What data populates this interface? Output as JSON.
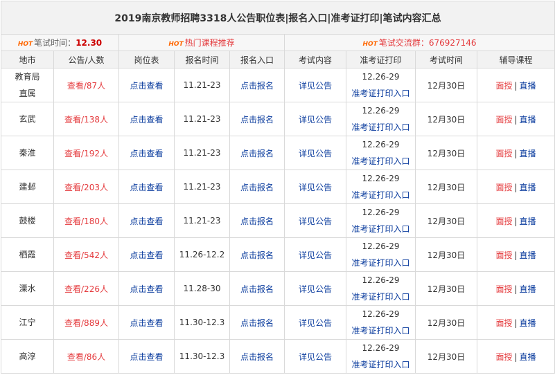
{
  "title": "2019南京教师招聘3318人公告职位表|报名入口|准考证打印|笔试内容汇总",
  "info": {
    "hot_tag": "HOT",
    "exam_time_label": "笔试时间：",
    "exam_time_value": "12.30",
    "hot_courses": "热门课程推荐",
    "group_label": "笔试交流群：",
    "group_value": "676927146"
  },
  "headers": [
    "地市",
    "公告/人数",
    "岗位表",
    "报名时间",
    "报名入口",
    "考试内容",
    "准考证打印",
    "考试时间",
    "辅导课程"
  ],
  "rows": [
    {
      "city": "教育局直属",
      "notice": "查看/87人",
      "positions": "点击查看",
      "reg_time": "11.21-23",
      "reg_entry": "点击报名",
      "content": "详见公告",
      "ticket_date": "12.26-29",
      "ticket_link": "准考证打印入口",
      "exam_date": "12月30日",
      "course_a": "面授",
      "course_b": "直播"
    },
    {
      "city": "玄武",
      "notice": "查看/138人",
      "positions": "点击查看",
      "reg_time": "11.21-23",
      "reg_entry": "点击报名",
      "content": "详见公告",
      "ticket_date": "12.26-29",
      "ticket_link": "准考证打印入口",
      "exam_date": "12月30日",
      "course_a": "面授",
      "course_b": "直播"
    },
    {
      "city": "秦淮",
      "notice": "查看/192人",
      "positions": "点击查看",
      "reg_time": "11.21-23",
      "reg_entry": "点击报名",
      "content": "详见公告",
      "ticket_date": "12.26-29",
      "ticket_link": "准考证打印入口",
      "exam_date": "12月30日",
      "course_a": "面授",
      "course_b": "直播"
    },
    {
      "city": "建邺",
      "notice": "查看/203人",
      "positions": "点击查看",
      "reg_time": "11.21-23",
      "reg_entry": "点击报名",
      "content": "详见公告",
      "ticket_date": "12.26-29",
      "ticket_link": "准考证打印入口",
      "exam_date": "12月30日",
      "course_a": "面授",
      "course_b": "直播"
    },
    {
      "city": "鼓楼",
      "notice": "查看/180人",
      "positions": "点击查看",
      "reg_time": "11.21-23",
      "reg_entry": "点击报名",
      "content": "详见公告",
      "ticket_date": "12.26-29",
      "ticket_link": "准考证打印入口",
      "exam_date": "12月30日",
      "course_a": "面授",
      "course_b": "直播"
    },
    {
      "city": "栖霞",
      "notice": "查看/542人",
      "positions": "点击查看",
      "reg_time": "11.26-12.2",
      "reg_entry": "点击报名",
      "content": "详见公告",
      "ticket_date": "12.26-29",
      "ticket_link": "准考证打印入口",
      "exam_date": "12月30日",
      "course_a": "面授",
      "course_b": "直播"
    },
    {
      "city": "溧水",
      "notice": "查看/226人",
      "positions": "点击查看",
      "reg_time": "11.28-30",
      "reg_entry": "点击报名",
      "content": "详见公告",
      "ticket_date": "12.26-29",
      "ticket_link": "准考证打印入口",
      "exam_date": "12月30日",
      "course_a": "面授",
      "course_b": "直播"
    },
    {
      "city": "江宁",
      "notice": "查看/889人",
      "positions": "点击查看",
      "reg_time": "11.30-12.3",
      "reg_entry": "点击报名",
      "content": "详见公告",
      "ticket_date": "12.26-29",
      "ticket_link": "准考证打印入口",
      "exam_date": "12月30日",
      "course_a": "面授",
      "course_b": "直播"
    },
    {
      "city": "高淳",
      "notice": "查看/86人",
      "positions": "点击查看",
      "reg_time": "11.30-12.3",
      "reg_entry": "点击报名",
      "content": "详见公告",
      "ticket_date": "12.26-29",
      "ticket_link": "准考证打印入口",
      "exam_date": "12月30日",
      "course_a": "面授",
      "course_b": "直播"
    }
  ],
  "colors": {
    "red_link": "#e4393c",
    "blue_link": "#0b3c9e",
    "hot_tag": "#ff6600",
    "header_bg": "#f2f2f2"
  }
}
